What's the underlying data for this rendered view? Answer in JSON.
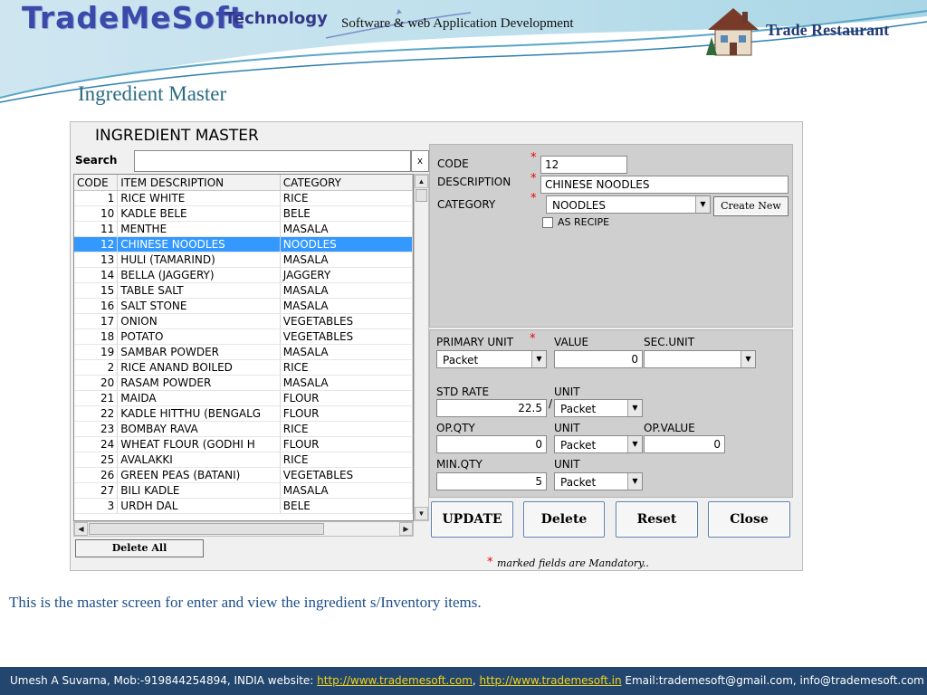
{
  "header": {
    "logo_main": "TradeMeSoft",
    "logo_sub": "Technology",
    "tagline": "Software & web Application Development",
    "brand": "Trade Restaurant",
    "accent_color": "#3a4aa8"
  },
  "slide_title": "Ingredient Master",
  "app": {
    "title": "INGREDIENT MASTER",
    "search": {
      "label": "Search",
      "value": "",
      "clear": "x"
    },
    "grid": {
      "columns": [
        "CODE",
        "ITEM DESCRIPTION",
        "CATEGORY"
      ],
      "selected_code": "12",
      "rows": [
        {
          "code": "1",
          "desc": "RICE WHITE",
          "cat": "RICE"
        },
        {
          "code": "10",
          "desc": "KADLE BELE",
          "cat": "BELE"
        },
        {
          "code": "11",
          "desc": "MENTHE",
          "cat": "MASALA"
        },
        {
          "code": "12",
          "desc": "CHINESE NOODLES",
          "cat": "NOODLES"
        },
        {
          "code": "13",
          "desc": "HULI (TAMARIND)",
          "cat": "MASALA"
        },
        {
          "code": "14",
          "desc": "BELLA (JAGGERY)",
          "cat": "JAGGERY"
        },
        {
          "code": "15",
          "desc": "TABLE SALT",
          "cat": "MASALA"
        },
        {
          "code": "16",
          "desc": "SALT STONE",
          "cat": "MASALA"
        },
        {
          "code": "17",
          "desc": "ONION",
          "cat": "VEGETABLES"
        },
        {
          "code": "18",
          "desc": "POTATO",
          "cat": "VEGETABLES"
        },
        {
          "code": "19",
          "desc": "SAMBAR POWDER",
          "cat": "MASALA"
        },
        {
          "code": "2",
          "desc": "RICE ANAND BOILED",
          "cat": "RICE"
        },
        {
          "code": "20",
          "desc": "RASAM POWDER",
          "cat": "MASALA"
        },
        {
          "code": "21",
          "desc": "MAIDA",
          "cat": "FLOUR"
        },
        {
          "code": "22",
          "desc": "KADLE HITTHU (BENGALG",
          "cat": "FLOUR"
        },
        {
          "code": "23",
          "desc": "BOMBAY RAVA",
          "cat": "RICE"
        },
        {
          "code": "24",
          "desc": "WHEAT FLOUR (GODHI H",
          "cat": "FLOUR"
        },
        {
          "code": "25",
          "desc": "AVALAKKI",
          "cat": "RICE"
        },
        {
          "code": "26",
          "desc": "GREEN PEAS (BATANI)",
          "cat": "VEGETABLES"
        },
        {
          "code": "27",
          "desc": "BILI KADLE",
          "cat": "MASALA"
        },
        {
          "code": "3",
          "desc": "URDH DAL",
          "cat": "BELE"
        }
      ]
    },
    "delete_all": "Delete All",
    "form": {
      "code_label": "CODE",
      "code_value": "12",
      "description_label": "DESCRIPTION",
      "description_value": "CHINESE NOODLES",
      "category_label": "CATEGORY",
      "category_value": "NOODLES",
      "create_new": "Create New",
      "as_recipe": "AS RECIPE",
      "primary_unit_label": "PRIMARY UNIT",
      "primary_unit_value": "Packet",
      "value_label": "VALUE",
      "value_value": "0",
      "sec_unit_label": "SEC.UNIT",
      "sec_unit_value": "",
      "std_rate_label": "STD RATE",
      "std_rate_value": "22.5",
      "slash": "/",
      "unit_label": "UNIT",
      "std_unit_value": "Packet",
      "op_qty_label": "OP.QTY",
      "op_qty_value": "0",
      "op_unit_value": "Packet",
      "op_value_label": "OP.VALUE",
      "op_value_value": "0",
      "min_qty_label": "MIN.QTY",
      "min_qty_value": "5",
      "min_unit_value": "Packet",
      "required_mark": "*"
    },
    "buttons": {
      "update": "UPDATE",
      "delete": "Delete",
      "reset": "Reset",
      "close": "Close"
    },
    "mandatory_note": "marked fields are Mandatory.."
  },
  "caption": "This is the master screen for enter and view the ingredient s/Inventory items.",
  "footer": {
    "text1": "Umesh A Suvarna, Mob:-919844254894, INDIA   website: ",
    "link1": "http://www.trademesoft.com",
    "sep": ",  ",
    "link2": "http://www.trademesoft.in",
    "text2": "  Email:trademesoft@gmail.com, info@trademesoft.com"
  }
}
